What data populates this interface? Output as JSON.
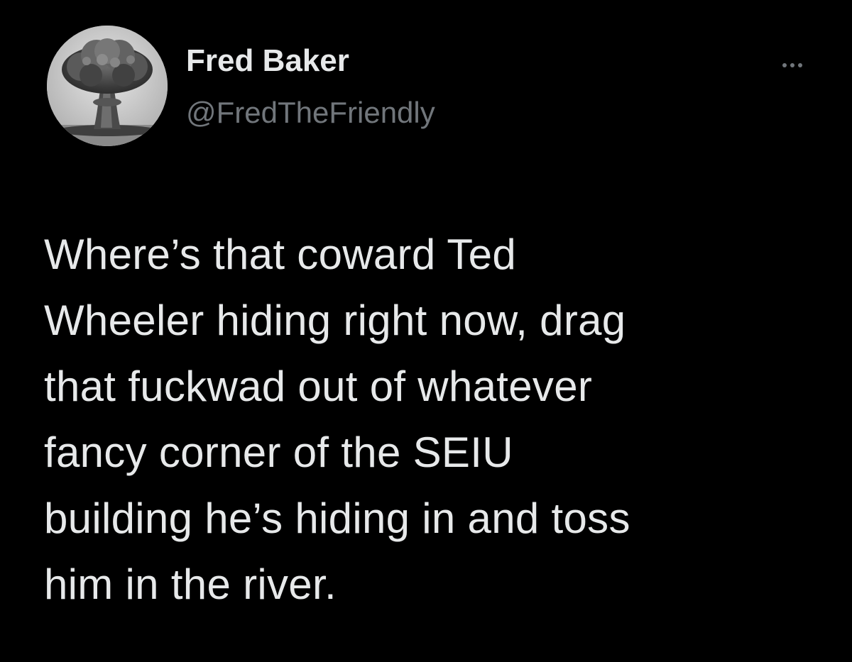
{
  "author": {
    "display_name": "Fred Baker",
    "handle": "@FredTheFriendly",
    "avatar_icon": "mushroom-cloud-avatar"
  },
  "menu": {
    "icon": "more-options-icon"
  },
  "tweet": {
    "text": "Where’s that coward Ted\nWheeler hiding right now, drag\nthat fuckwad out of whatever\nfancy corner of the SEIU\nbuilding he’s hiding in and toss\nhim in the river."
  },
  "colors": {
    "background": "#000000",
    "primary_text": "#e7e9ea",
    "secondary_text": "#71767b"
  }
}
